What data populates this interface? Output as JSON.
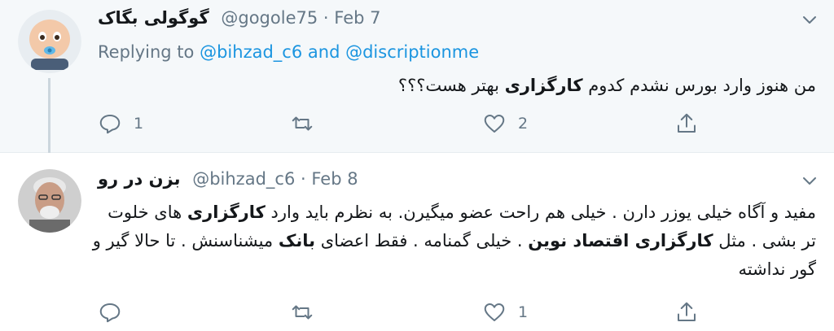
{
  "tweets": [
    {
      "name": "گوگولی بگاک",
      "handle": "@gogole75",
      "separator": "·",
      "date": "Feb 7",
      "replying_prefix": "Replying to",
      "replying_user1": "@bihzad_c6",
      "replying_and": "and",
      "replying_user2": "@discriptionme",
      "body_pre": "من هنوز وارد بورس نشدم کدوم ",
      "body_bold": "کارگزاری",
      "body_post": " بهتر هست؟؟؟",
      "reply_count": "1",
      "retweet_count": "",
      "like_count": "2"
    },
    {
      "name": "بزن در رو",
      "handle": "@bihzad_c6",
      "separator": "·",
      "date": "Feb 8",
      "body_1": "مفید و آگاه خیلی یوزر دارن . خیلی هم راحت عضو میگیرن. به نظرم باید وارد ",
      "body_2_bold": "کارگزاری",
      "body_3": " های خلوت تر بشی . مثل ",
      "body_4_bold": "کارگزاری اقتصاد نوین",
      "body_5": " . خیلی گمنامه . فقط اعضای ",
      "body_6_bold": "بانک",
      "body_7": " میشناسنش . تا حالا گیر و گور نداشته",
      "reply_count": "",
      "retweet_count": "",
      "like_count": "1"
    }
  ],
  "colors": {
    "accent": "#1b95e0",
    "muted": "#657786",
    "text": "#14171a",
    "highlight_bg": "#f5f8fa"
  }
}
